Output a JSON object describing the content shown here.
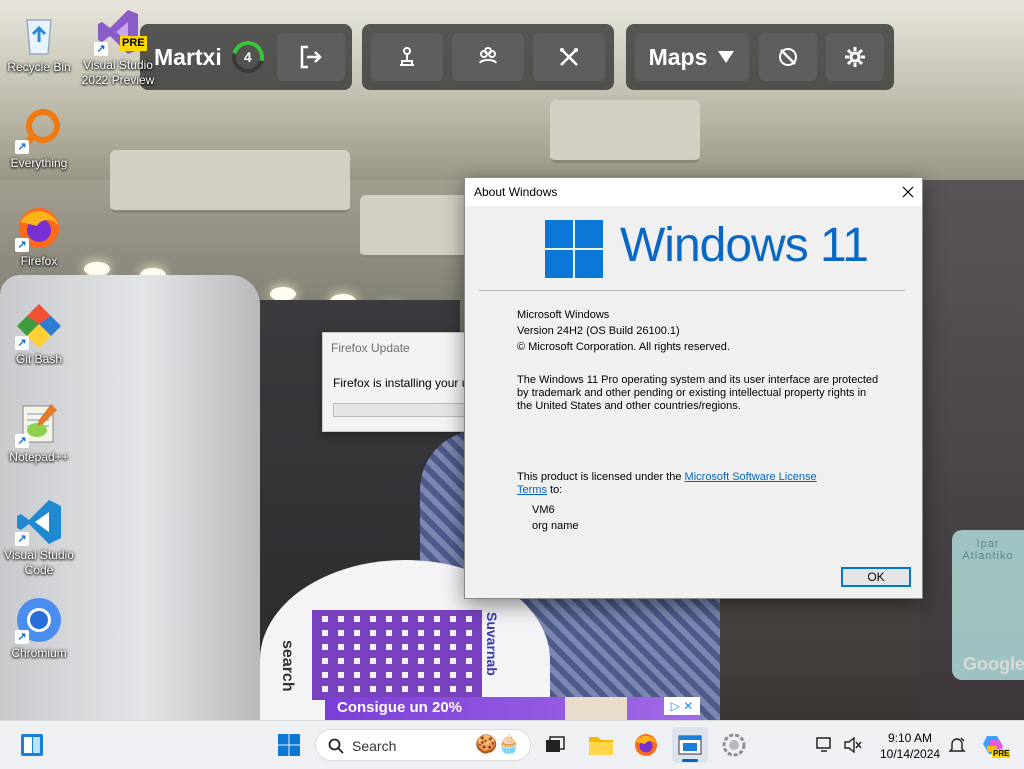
{
  "desktop": {
    "icons": [
      {
        "label": "Recycle Bin",
        "icon": "recycle-bin-icon"
      },
      {
        "label": "Visual Studio 2022 Preview",
        "icon": "visual-studio-preview-icon",
        "badge": "PRE"
      },
      {
        "label": "Everything",
        "icon": "everything-search-icon"
      },
      {
        "label": "Firefox",
        "icon": "firefox-icon"
      },
      {
        "label": "Git Bash",
        "icon": "git-bash-icon"
      },
      {
        "label": "Notepad++",
        "icon": "notepad-plus-plus-icon"
      },
      {
        "label": "Visual Studio Code",
        "icon": "vscode-icon"
      },
      {
        "label": "Chromium",
        "icon": "chromium-icon"
      }
    ]
  },
  "streetview_toolbar": {
    "username": "Martxi",
    "level": "4",
    "maps_label": "Maps",
    "buttons": [
      "logout-icon",
      "people-icon",
      "group-icon",
      "crossed-tools-icon",
      "compass-off-icon",
      "gear-icon"
    ]
  },
  "wallpaper": {
    "qr_text": "search",
    "qr_side_text": "Suvarnab",
    "map_label": "Ipar Atlantiko",
    "google": "Google",
    "ad_text": "Consigue un 20%"
  },
  "firefox_update": {
    "title": "Firefox Update",
    "message": "Firefox is installing your upd"
  },
  "about": {
    "title": "About Windows",
    "wordmark": "Windows 11",
    "lines": {
      "product": "Microsoft Windows",
      "version": "Version 24H2 (OS Build 26100.1)",
      "copyright": "© Microsoft Corporation. All rights reserved.",
      "notice_1": "The Windows 11 Pro operating system and its user interface are protected",
      "notice_2": "by trademark and other pending or existing intellectual property rights in",
      "notice_3": "the United States and other countries/regions.",
      "license_prefix": "This product is licensed under the ",
      "license_link_1": "Microsoft Software License",
      "license_link_2": "Terms",
      "license_suffix": " to:",
      "user": "VM6",
      "org": "org name"
    },
    "ok_label": "OK"
  },
  "taskbar": {
    "search_placeholder": "Search",
    "time": "9:10 AM",
    "date": "10/14/2024",
    "copilot_badge": "PRE"
  },
  "colors": {
    "windows_blue": "#0a68c4",
    "link": "#0563c1",
    "accent": "#0078d4"
  }
}
